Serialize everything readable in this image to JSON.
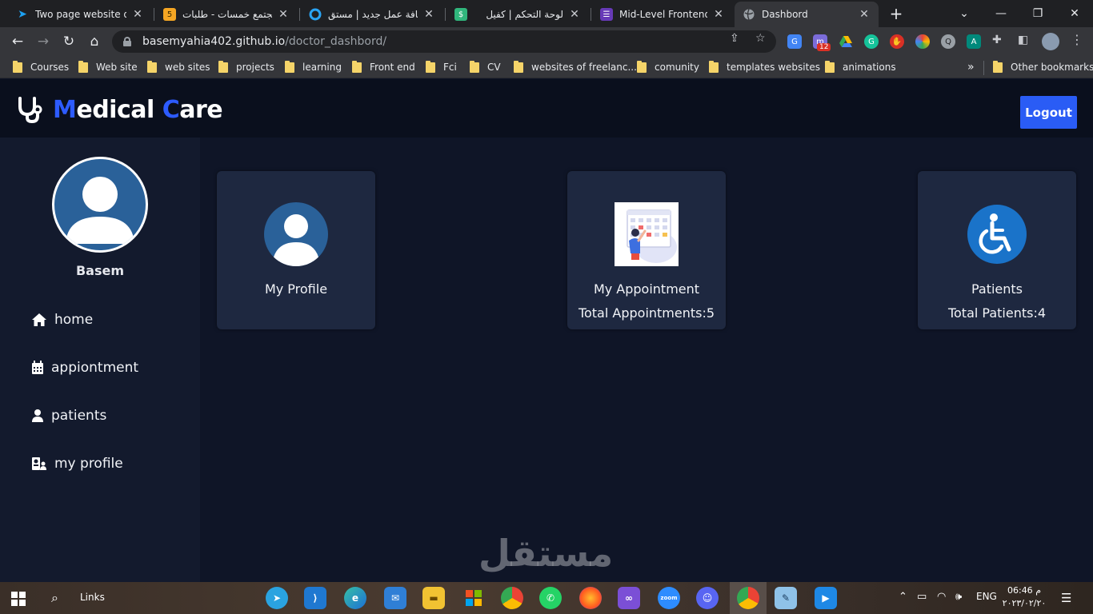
{
  "browser": {
    "tabs": [
      {
        "title": "Two page website des",
        "icon": "bird-icon",
        "color": "#1da1f2"
      },
      {
        "title": "مجتمع خمسات - طلبات",
        "icon": "khamsat-icon",
        "color": "#f5a623"
      },
      {
        "title": "إضافة عمل جديد | مستق",
        "icon": "mostaql-icon",
        "color": "#2aa4f4"
      },
      {
        "title": "لوحة التحكم | كفيل",
        "icon": "kafiil-icon",
        "color": "#30b67c"
      },
      {
        "title": "Mid-Level Frontend D",
        "icon": "form-icon",
        "color": "#673ab7"
      },
      {
        "title": "Dashbord",
        "icon": "globe-icon",
        "color": "#9aa0a6"
      }
    ],
    "url_host": "basemyahia402.github.io",
    "url_path": "/doctor_dashbord/",
    "extension_badge": "12",
    "bookmarks": [
      "Courses",
      "Web site",
      "web sites",
      "projects",
      "learning",
      "Front end",
      "Fci",
      "CV",
      "websites of freelanc...",
      "comunity",
      "templates websites",
      "animations"
    ],
    "more_bookmarks": "»",
    "other_bookmarks": "Other bookmarks"
  },
  "app": {
    "logo": {
      "m": "M",
      "edical": "edical ",
      "c": "C",
      "are": "are"
    },
    "logout_label": "Logout",
    "user_name": "Basem",
    "nav": [
      {
        "label": "home",
        "icon": "home-icon"
      },
      {
        "label": "appiontment",
        "icon": "calendar-icon"
      },
      {
        "label": "patients",
        "icon": "user-icon"
      },
      {
        "label": "my profile",
        "icon": "id-card-icon"
      }
    ],
    "cards": [
      {
        "title": "My Profile",
        "stat": "",
        "icon": "user-avatar-icon"
      },
      {
        "title": "My Appointment",
        "stat": "Total Appointments:5",
        "icon": "appointment-illustration"
      },
      {
        "title": "Patients",
        "stat": "Total Patients:4",
        "icon": "wheelchair-icon"
      }
    ],
    "accent_color": "#2a5cf5"
  },
  "watermark": "مستقل",
  "taskbar": {
    "links_label": "Links",
    "lang": "ENG",
    "time": "06:46 م",
    "date": "٢٠٢٣/٠٢/٢٠"
  }
}
